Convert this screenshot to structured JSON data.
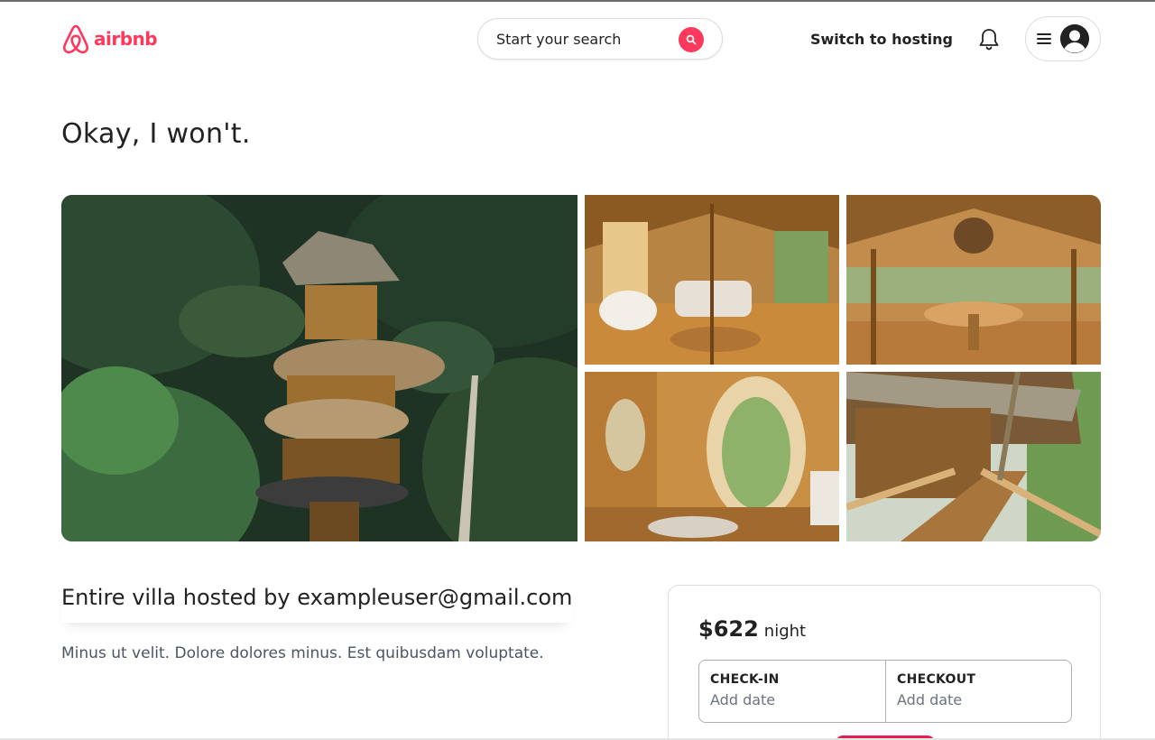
{
  "header": {
    "logo_text": "airbnb",
    "search_label": "Start your search",
    "switch_hosting": "Switch to hosting"
  },
  "page_title": "Okay, I won't.",
  "gallery": {
    "photos": [
      {
        "name": "bamboo treehouse villa in jungle"
      },
      {
        "name": "bamboo living room"
      },
      {
        "name": "bamboo dining room"
      },
      {
        "name": "bamboo bedroom with round window"
      },
      {
        "name": "bamboo walkway"
      }
    ]
  },
  "listing": {
    "host_title": "Entire villa hosted by exampleuser@gmail.com",
    "description": "Minus ut velit. Dolore dolores minus. Est quibusdam voluptate."
  },
  "booking": {
    "price": "$622",
    "per_night": "night",
    "checkin_label": "CHECK-IN",
    "checkin_value": "Add date",
    "checkout_label": "CHECKOUT",
    "checkout_value": "Add date"
  },
  "colors": {
    "brand": "#ff385c",
    "reserve": "#e61e4d",
    "text": "#222222",
    "muted": "#6b7280"
  },
  "icons": [
    "airbnb-logo-icon",
    "search-icon",
    "bell-icon",
    "hamburger-icon",
    "user-avatar-icon"
  ]
}
